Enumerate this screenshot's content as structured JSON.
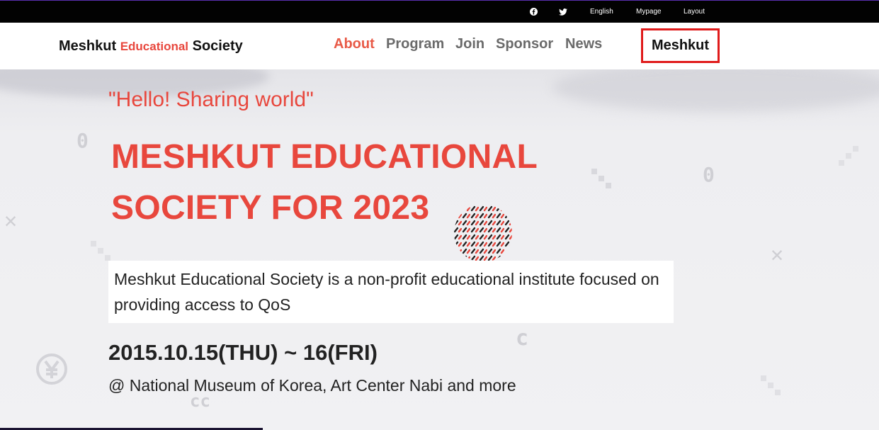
{
  "topbar": {
    "icons": [
      "facebook-icon",
      "twitter-icon"
    ],
    "links": [
      "English",
      "Mypage",
      "Layout"
    ]
  },
  "header": {
    "logo": {
      "part1": "Meshkut ",
      "accent": "Educational",
      "part2": " Society"
    },
    "nav": [
      "About",
      "Program",
      "Join",
      "Sponsor",
      "News"
    ],
    "active_nav": "About",
    "brand_button": "Meshkut"
  },
  "hero": {
    "tagline": "\"Hello! Sharing world\"",
    "title_line1": "MESHKUT EDUCATIONAL",
    "title_line2": "SOCIETY FOR 2023",
    "description": "Meshkut Educational Society is a non-profit educational institute focused on providing access to QoS",
    "date": "2015.10.15(THU) ~ 16(FRI)",
    "venue": "@ National Museum of Korea, Art Center Nabi and more"
  },
  "colors": {
    "accent": "#e8473d",
    "topbar": "#020202",
    "highlight_border": "#e01b1b"
  }
}
